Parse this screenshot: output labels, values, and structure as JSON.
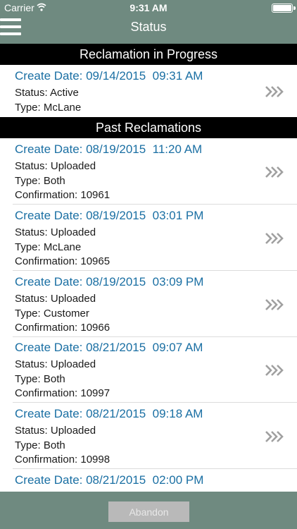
{
  "status_bar": {
    "carrier": "Carrier",
    "time": "9:31 AM"
  },
  "navbar": {
    "title": "Status"
  },
  "in_progress": {
    "header": "Reclamation in Progress",
    "items": [
      {
        "date": "Create Date: 09/14/2015  09:31 AM",
        "status": "Status: Active",
        "type": "Type: McLane"
      }
    ]
  },
  "past": {
    "header": "Past Reclamations",
    "items": [
      {
        "date": "Create Date: 08/19/2015  11:20 AM",
        "status": "Status: Uploaded",
        "type": "Type: Both",
        "confirmation": "Confirmation: 10961"
      },
      {
        "date": "Create Date: 08/19/2015  03:01 PM",
        "status": "Status: Uploaded",
        "type": "Type: McLane",
        "confirmation": "Confirmation: 10965"
      },
      {
        "date": "Create Date: 08/19/2015  03:09 PM",
        "status": "Status: Uploaded",
        "type": "Type: Customer",
        "confirmation": "Confirmation: 10966"
      },
      {
        "date": "Create Date: 08/21/2015  09:07 AM",
        "status": "Status: Uploaded",
        "type": "Type: Both",
        "confirmation": "Confirmation: 10997"
      },
      {
        "date": "Create Date: 08/21/2015  09:18 AM",
        "status": "Status: Uploaded",
        "type": "Type: Both",
        "confirmation": "Confirmation: 10998"
      },
      {
        "date": "Create Date: 08/21/2015  02:00 PM"
      }
    ]
  },
  "bottom": {
    "abandon_label": "Abandon"
  },
  "colors": {
    "bar": "#6f8a80",
    "link": "#1a6fa3",
    "header": "#000000"
  }
}
